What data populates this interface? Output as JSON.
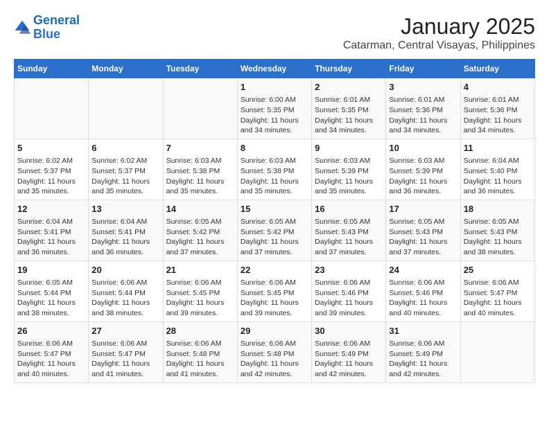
{
  "logo": {
    "line1": "General",
    "line2": "Blue"
  },
  "title": "January 2025",
  "subtitle": "Catarman, Central Visayas, Philippines",
  "days_of_week": [
    "Sunday",
    "Monday",
    "Tuesday",
    "Wednesday",
    "Thursday",
    "Friday",
    "Saturday"
  ],
  "weeks": [
    [
      {
        "day": "",
        "info": ""
      },
      {
        "day": "",
        "info": ""
      },
      {
        "day": "",
        "info": ""
      },
      {
        "day": "1",
        "info": "Sunrise: 6:00 AM\nSunset: 5:35 PM\nDaylight: 11 hours and 34 minutes."
      },
      {
        "day": "2",
        "info": "Sunrise: 6:01 AM\nSunset: 5:35 PM\nDaylight: 11 hours and 34 minutes."
      },
      {
        "day": "3",
        "info": "Sunrise: 6:01 AM\nSunset: 5:36 PM\nDaylight: 11 hours and 34 minutes."
      },
      {
        "day": "4",
        "info": "Sunrise: 6:01 AM\nSunset: 5:36 PM\nDaylight: 11 hours and 34 minutes."
      }
    ],
    [
      {
        "day": "5",
        "info": "Sunrise: 6:02 AM\nSunset: 5:37 PM\nDaylight: 11 hours and 35 minutes."
      },
      {
        "day": "6",
        "info": "Sunrise: 6:02 AM\nSunset: 5:37 PM\nDaylight: 11 hours and 35 minutes."
      },
      {
        "day": "7",
        "info": "Sunrise: 6:03 AM\nSunset: 5:38 PM\nDaylight: 11 hours and 35 minutes."
      },
      {
        "day": "8",
        "info": "Sunrise: 6:03 AM\nSunset: 5:38 PM\nDaylight: 11 hours and 35 minutes."
      },
      {
        "day": "9",
        "info": "Sunrise: 6:03 AM\nSunset: 5:39 PM\nDaylight: 11 hours and 35 minutes."
      },
      {
        "day": "10",
        "info": "Sunrise: 6:03 AM\nSunset: 5:39 PM\nDaylight: 11 hours and 36 minutes."
      },
      {
        "day": "11",
        "info": "Sunrise: 6:04 AM\nSunset: 5:40 PM\nDaylight: 11 hours and 36 minutes."
      }
    ],
    [
      {
        "day": "12",
        "info": "Sunrise: 6:04 AM\nSunset: 5:41 PM\nDaylight: 11 hours and 36 minutes."
      },
      {
        "day": "13",
        "info": "Sunrise: 6:04 AM\nSunset: 5:41 PM\nDaylight: 11 hours and 36 minutes."
      },
      {
        "day": "14",
        "info": "Sunrise: 6:05 AM\nSunset: 5:42 PM\nDaylight: 11 hours and 37 minutes."
      },
      {
        "day": "15",
        "info": "Sunrise: 6:05 AM\nSunset: 5:42 PM\nDaylight: 11 hours and 37 minutes."
      },
      {
        "day": "16",
        "info": "Sunrise: 6:05 AM\nSunset: 5:43 PM\nDaylight: 11 hours and 37 minutes."
      },
      {
        "day": "17",
        "info": "Sunrise: 6:05 AM\nSunset: 5:43 PM\nDaylight: 11 hours and 37 minutes."
      },
      {
        "day": "18",
        "info": "Sunrise: 6:05 AM\nSunset: 5:43 PM\nDaylight: 11 hours and 38 minutes."
      }
    ],
    [
      {
        "day": "19",
        "info": "Sunrise: 6:05 AM\nSunset: 5:44 PM\nDaylight: 11 hours and 38 minutes."
      },
      {
        "day": "20",
        "info": "Sunrise: 6:06 AM\nSunset: 5:44 PM\nDaylight: 11 hours and 38 minutes."
      },
      {
        "day": "21",
        "info": "Sunrise: 6:06 AM\nSunset: 5:45 PM\nDaylight: 11 hours and 39 minutes."
      },
      {
        "day": "22",
        "info": "Sunrise: 6:06 AM\nSunset: 5:45 PM\nDaylight: 11 hours and 39 minutes."
      },
      {
        "day": "23",
        "info": "Sunrise: 6:06 AM\nSunset: 5:46 PM\nDaylight: 11 hours and 39 minutes."
      },
      {
        "day": "24",
        "info": "Sunrise: 6:06 AM\nSunset: 5:46 PM\nDaylight: 11 hours and 40 minutes."
      },
      {
        "day": "25",
        "info": "Sunrise: 6:06 AM\nSunset: 5:47 PM\nDaylight: 11 hours and 40 minutes."
      }
    ],
    [
      {
        "day": "26",
        "info": "Sunrise: 6:06 AM\nSunset: 5:47 PM\nDaylight: 11 hours and 40 minutes."
      },
      {
        "day": "27",
        "info": "Sunrise: 6:06 AM\nSunset: 5:47 PM\nDaylight: 11 hours and 41 minutes."
      },
      {
        "day": "28",
        "info": "Sunrise: 6:06 AM\nSunset: 5:48 PM\nDaylight: 11 hours and 41 minutes."
      },
      {
        "day": "29",
        "info": "Sunrise: 6:06 AM\nSunset: 5:48 PM\nDaylight: 11 hours and 42 minutes."
      },
      {
        "day": "30",
        "info": "Sunrise: 6:06 AM\nSunset: 5:49 PM\nDaylight: 11 hours and 42 minutes."
      },
      {
        "day": "31",
        "info": "Sunrise: 6:06 AM\nSunset: 5:49 PM\nDaylight: 11 hours and 42 minutes."
      },
      {
        "day": "",
        "info": ""
      }
    ]
  ]
}
